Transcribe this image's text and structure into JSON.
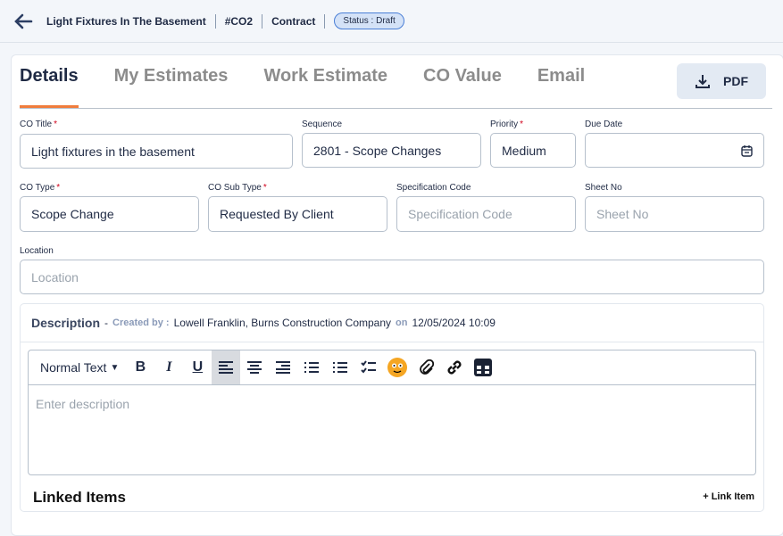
{
  "header": {
    "title": "Light Fixtures In The Basement",
    "number": "#CO2",
    "type": "Contract",
    "status": "Status : Draft"
  },
  "tabs": [
    {
      "label": "Details"
    },
    {
      "label": "My Estimates"
    },
    {
      "label": "Work Estimate"
    },
    {
      "label": "CO Value"
    },
    {
      "label": "Email"
    }
  ],
  "pdf_label": "PDF",
  "fields": {
    "co_title": {
      "label": "CO Title",
      "value": "Light fixtures in the basement"
    },
    "sequence": {
      "label": "Sequence",
      "value": "2801 - Scope Changes"
    },
    "priority": {
      "label": "Priority",
      "value": "Medium"
    },
    "due_date": {
      "label": "Due Date",
      "value": ""
    },
    "co_type": {
      "label": "CO Type",
      "value": "Scope Change"
    },
    "co_sub_type": {
      "label": "CO Sub Type",
      "value": "Requested By Client"
    },
    "spec_code": {
      "label": "Specification Code",
      "placeholder": "Specification Code"
    },
    "sheet_no": {
      "label": "Sheet No",
      "placeholder": "Sheet No"
    },
    "location": {
      "label": "Location",
      "placeholder": "Location"
    }
  },
  "description": {
    "title": "Description",
    "dash": "-",
    "created_by_label": "Created by :",
    "created_by": "Lowell Franklin, Burns Construction Company",
    "on_label": "on",
    "date": "12/05/2024 10:09",
    "format": "Normal Text",
    "placeholder": "Enter description"
  },
  "linked": {
    "title": "Linked Items",
    "button": "+ Link Item"
  },
  "required_mark": "*"
}
